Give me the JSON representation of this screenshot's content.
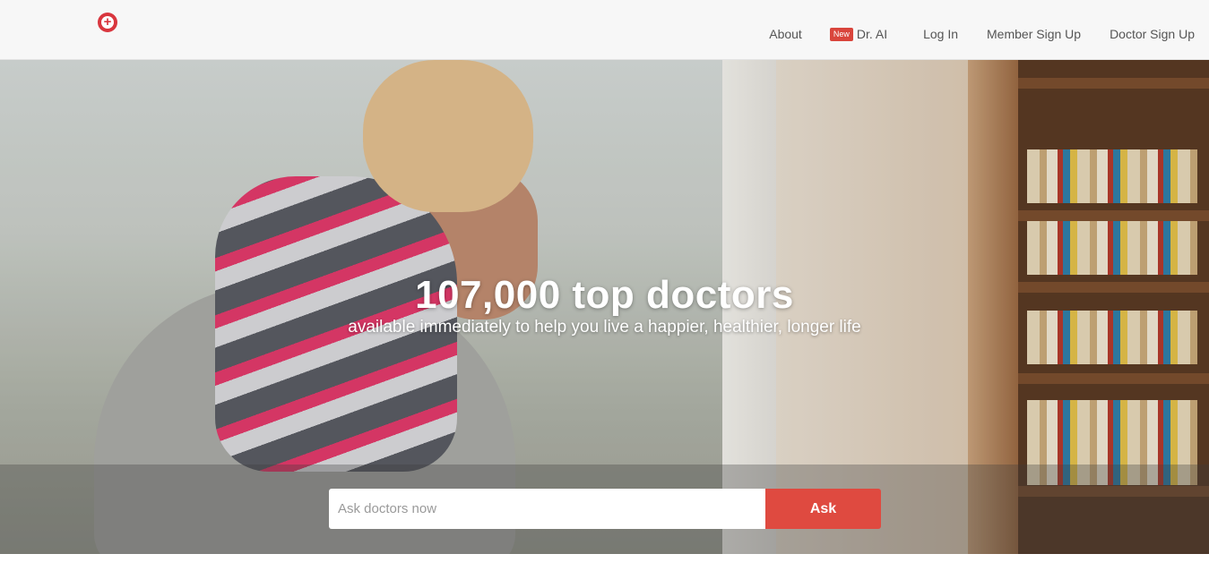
{
  "header": {
    "logo_word": "",
    "nav": {
      "about": "About",
      "new_badge": "New",
      "dr_ai": "Dr. AI",
      "login": "Log In",
      "member_signup": "Member Sign Up",
      "doctor_signup": "Doctor Sign Up"
    }
  },
  "hero": {
    "headline": "107,000 top doctors",
    "subline": "available immediately to help you live a happier, healthier, longer life",
    "image": "father-hugging-daughter-photo"
  },
  "search": {
    "placeholder": "Ask doctors now",
    "value": "",
    "button_label": "Ask"
  },
  "colors": {
    "accent": "#df4a40",
    "badge": "#d9453c",
    "header_bg": "#f7f7f7",
    "nav_text": "#555555"
  }
}
